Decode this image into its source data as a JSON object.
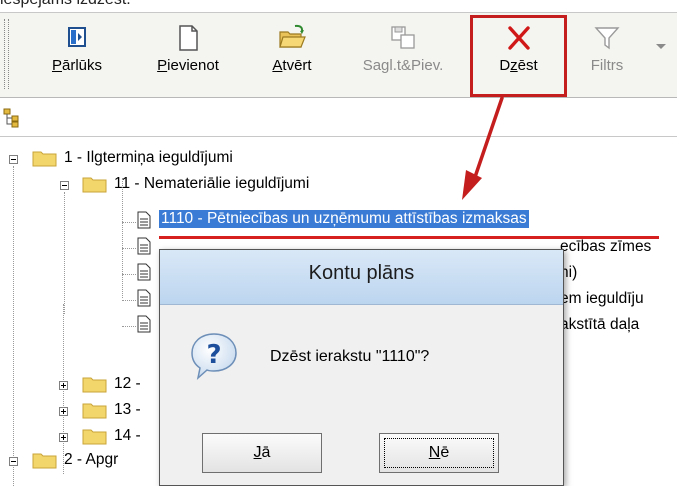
{
  "caption": "iespējams izdzēst.",
  "toolbar": {
    "buttons": [
      {
        "label": "Pārlūks",
        "icon": "browser-panel-icon",
        "enabled": true
      },
      {
        "label": "Pievienot",
        "icon": "new-document-icon",
        "enabled": true
      },
      {
        "label": "Atvērt",
        "icon": "open-folder-icon",
        "enabled": true
      },
      {
        "label": "Sagl.t&Piev.",
        "icon": "save-and-add-icon",
        "enabled": false
      },
      {
        "label": "Dzēst",
        "icon": "delete-x-icon",
        "enabled": true
      },
      {
        "label": "Filtrs",
        "icon": "funnel-filter-icon",
        "enabled": false
      }
    ]
  },
  "tree": {
    "n1": "1 - Ilgtermiņa ieguldījumi",
    "n11": "11 - Nemateriālie ieguldījumi",
    "n1110": "1110 - Pētniecības un uzņēmumu attīstības izmaksas",
    "p1": "ecības zīmes",
    "p2": "ni)",
    "p3": "em ieguldīju",
    "p4": "akstītā daļa",
    "n12": "12 -",
    "n13": "13 -",
    "n14": "14 -",
    "n2": "2 - Apgr"
  },
  "dialog": {
    "title": "Kontu plāns",
    "message": "Dzēst ierakstu \"1110\"?",
    "yes_label": "Jā",
    "no_label": "Nē"
  },
  "colors": {
    "highlight": "#c41e1e",
    "selection": "#3a7bd5",
    "folder": "#f3d66b"
  }
}
